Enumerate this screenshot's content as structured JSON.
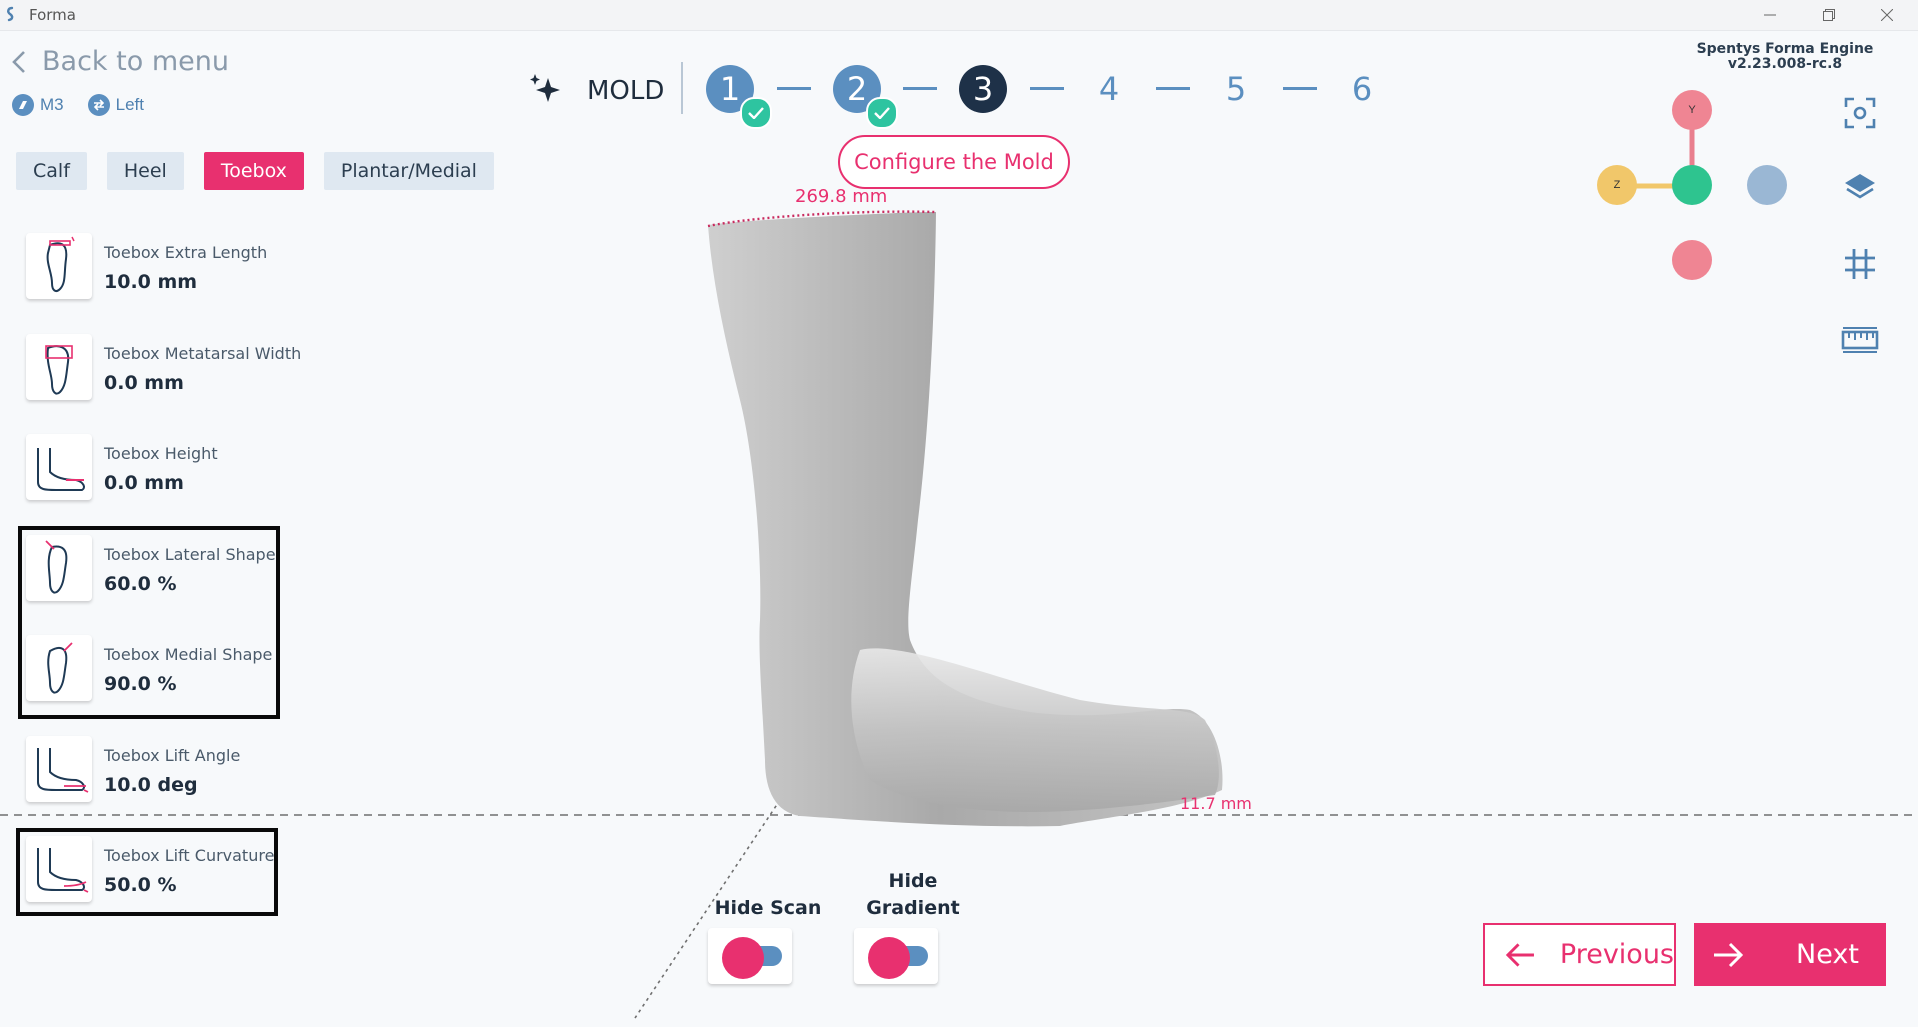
{
  "window": {
    "title": "Forma",
    "minimize_icon": "minimize-icon",
    "restore_icon": "restore-icon",
    "close_icon": "close-icon"
  },
  "header": {
    "back_label": "Back to menu",
    "model": "M3",
    "side": "Left",
    "engine_version": "Spentys Forma Engine v2.23.008-rc.8"
  },
  "tabs": [
    {
      "label": "Calf",
      "active": false
    },
    {
      "label": "Heel",
      "active": false
    },
    {
      "label": "Toebox",
      "active": true
    },
    {
      "label": "Plantar/Medial",
      "active": false
    }
  ],
  "parameters": [
    {
      "name": "Toebox Extra Length",
      "value": "10.0 mm"
    },
    {
      "name": "Toebox Metatarsal Width",
      "value": "0.0 mm"
    },
    {
      "name": "Toebox Height",
      "value": "0.0 mm"
    },
    {
      "name": "Toebox Lateral Shape",
      "value": "60.0 %"
    },
    {
      "name": "Toebox Medial Shape",
      "value": "90.0 %"
    },
    {
      "name": "Toebox Lift Angle",
      "value": "10.0 deg"
    },
    {
      "name": "Toebox Lift Curvature",
      "value": "50.0 %"
    }
  ],
  "stepper": {
    "section_label": "MOLD",
    "steps": [
      "1",
      "2",
      "3",
      "4",
      "5",
      "6"
    ],
    "completed": [
      1,
      2
    ],
    "current": 3,
    "tooltip": "Configure the Mold"
  },
  "viewport": {
    "top_measurement": "269.8 mm",
    "toe_measurement": "11.7 mm",
    "axes": {
      "y": "Y",
      "z": "Z"
    }
  },
  "toggles": {
    "hide_scan": "Hide Scan",
    "hide_gradient": "Hide Gradient"
  },
  "nav": {
    "previous": "Previous",
    "next": "Next"
  },
  "colors": {
    "accent": "#e8306f",
    "primary": "#5b8fc0",
    "dark": "#1e3148",
    "success": "#2ec4a0"
  }
}
